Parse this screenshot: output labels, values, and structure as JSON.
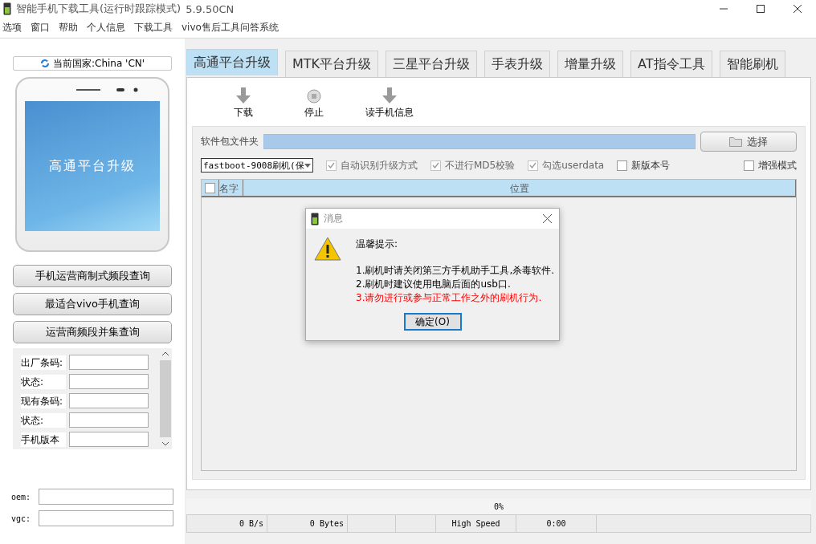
{
  "window": {
    "title": "智能手机下载工具(运行时跟踪模式)",
    "version": "5.9.50CN"
  },
  "menu": [
    "选项",
    "窗口",
    "帮助",
    "个人信息",
    "下载工具",
    "vivo售后工具问答系统"
  ],
  "sidebar": {
    "country": "当前国家:China 'CN'",
    "phone_screen_text": "高通平台升级",
    "buttons": [
      "手机运营商制式频段查询",
      "最适合vivo手机查询",
      "运营商频段并集查询"
    ],
    "form": [
      {
        "label": "出厂条码:"
      },
      {
        "label": "状态:"
      },
      {
        "label": "现有条码:"
      },
      {
        "label": "状态:"
      },
      {
        "label": "手机版本"
      }
    ],
    "extra_fields": [
      {
        "label": "oem:"
      },
      {
        "label": "vgc:"
      }
    ]
  },
  "tabs": [
    {
      "label": "高通平台升级",
      "selected": true
    },
    {
      "label": "MTK平台升级",
      "selected": false
    },
    {
      "label": "三星平台升级",
      "selected": false
    },
    {
      "label": "手表升级",
      "selected": false
    },
    {
      "label": "增量升级",
      "selected": false
    },
    {
      "label": "AT指令工具",
      "selected": false
    },
    {
      "label": "智能刷机",
      "selected": false
    }
  ],
  "toolbar": [
    {
      "label": "下载",
      "kind": "arrow"
    },
    {
      "label": "停止",
      "kind": "stop"
    },
    {
      "label": "读手机信息",
      "kind": "arrow"
    }
  ],
  "package_folder": {
    "label": "软件包文件夹",
    "button": "选择"
  },
  "mode_select": "fastboot-9008刷机(保",
  "options": [
    {
      "label": "自动识别升级方式",
      "checked": true,
      "disabled": true
    },
    {
      "label": "不进行MD5校验",
      "checked": true,
      "disabled": true
    },
    {
      "label": "勾选userdata",
      "checked": true,
      "disabled": true
    },
    {
      "label": "新版本号",
      "checked": false,
      "disabled": false
    },
    {
      "label": "增强模式",
      "checked": false,
      "disabled": false
    }
  ],
  "table": {
    "columns": [
      "名字",
      "位置"
    ],
    "select_all_checked": false
  },
  "dialog": {
    "title": "消息",
    "heading": "温馨提示:",
    "lines": [
      {
        "text": "1.刷机时请关闭第三方手机助手工具,杀毒软件.",
        "color": "#000000"
      },
      {
        "text": "2.刷机时建议使用电脑后面的usb口.",
        "color": "#000000"
      },
      {
        "text": "3.请勿进行或参与正常工作之外的刷机行为.",
        "color": "#ff0000"
      }
    ],
    "button": "确定(O)"
  },
  "progress": {
    "text": "0%",
    "level": 0
  },
  "status_bar": {
    "transfer": [
      "0 B/s",
      "0 Bytes"
    ],
    "info": [
      "High Speed",
      "0:00"
    ]
  }
}
